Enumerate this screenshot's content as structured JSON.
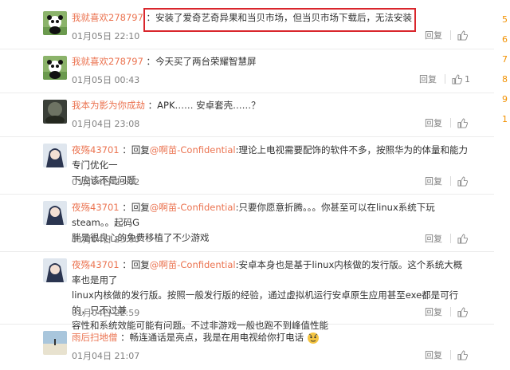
{
  "comments": [
    {
      "user": "我就喜欢278797",
      "separator": " ：",
      "text": "安装了爱奇艺奇异果和当贝市场，但当贝市场下载后，无法安装",
      "time": "01月05日 22:10",
      "reply": "回复",
      "likes": ""
    },
    {
      "user": "我就喜欢278797",
      "separator": " ：",
      "text": "今天买了两台荣耀智慧屏",
      "time": "01月05日 00:43",
      "reply": "回复",
      "likes": "1"
    },
    {
      "user": "我本为影为你成劫",
      "separator": " ：",
      "text": "APK…… 安卓套壳……？",
      "time": "01月04日 23:08",
      "reply": "回复",
      "likes": ""
    },
    {
      "user": "夜殇43701",
      "separator": " ：",
      "reply_word": "回复",
      "mention": "@啊苗-Confidential",
      "text_line1": ":理论上电视需要配饰的软件不多，按照华为的体量和能力专门优化一",
      "text_line2": "下应该不是问题",
      "time": "01月04日 23:02",
      "reply": "回复",
      "likes": ""
    },
    {
      "user": "夜殇43701",
      "separator": " ：",
      "reply_word": "回复",
      "mention": "@啊苗-Confidential",
      "text_line1": ":只要你愿意折腾。。。你甚至可以在linux系统下玩steam。。起码G",
      "text_line2": "胖是很良心的免费移植了不少游戏",
      "time": "01月04日 23:00",
      "reply": "回复",
      "likes": ""
    },
    {
      "user": "夜殇43701",
      "separator": " ：",
      "reply_word": "回复",
      "mention": "@啊苗-Confidential",
      "text_line1": ":安卓本身也是基于linux内核做的发行版。这个系统大概率也是用了",
      "text_line2": "linux内核做的发行版。按照一般发行版的经验，通过虚拟机运行安卓原生应用甚至exe都是可行的，只不过兼",
      "text_line3": "容性和系统效能可能有问题。不过非游戏一般也跑不到峰值性能",
      "time": "01月04日 22:59",
      "reply": "回复",
      "likes": ""
    },
    {
      "user": "雨后扫地僧",
      "separator": " ：",
      "text": "畅连通话是亮点，我是在用电视给你打电话",
      "time": "01月04日 21:07",
      "reply": "回复",
      "likes": ""
    }
  ],
  "side_numbers": [
    "5",
    "6",
    "7",
    "8",
    "9",
    "1"
  ],
  "colors": {
    "username": "#eb7350",
    "highlight_box": "#d9262c",
    "meta": "#808080"
  }
}
